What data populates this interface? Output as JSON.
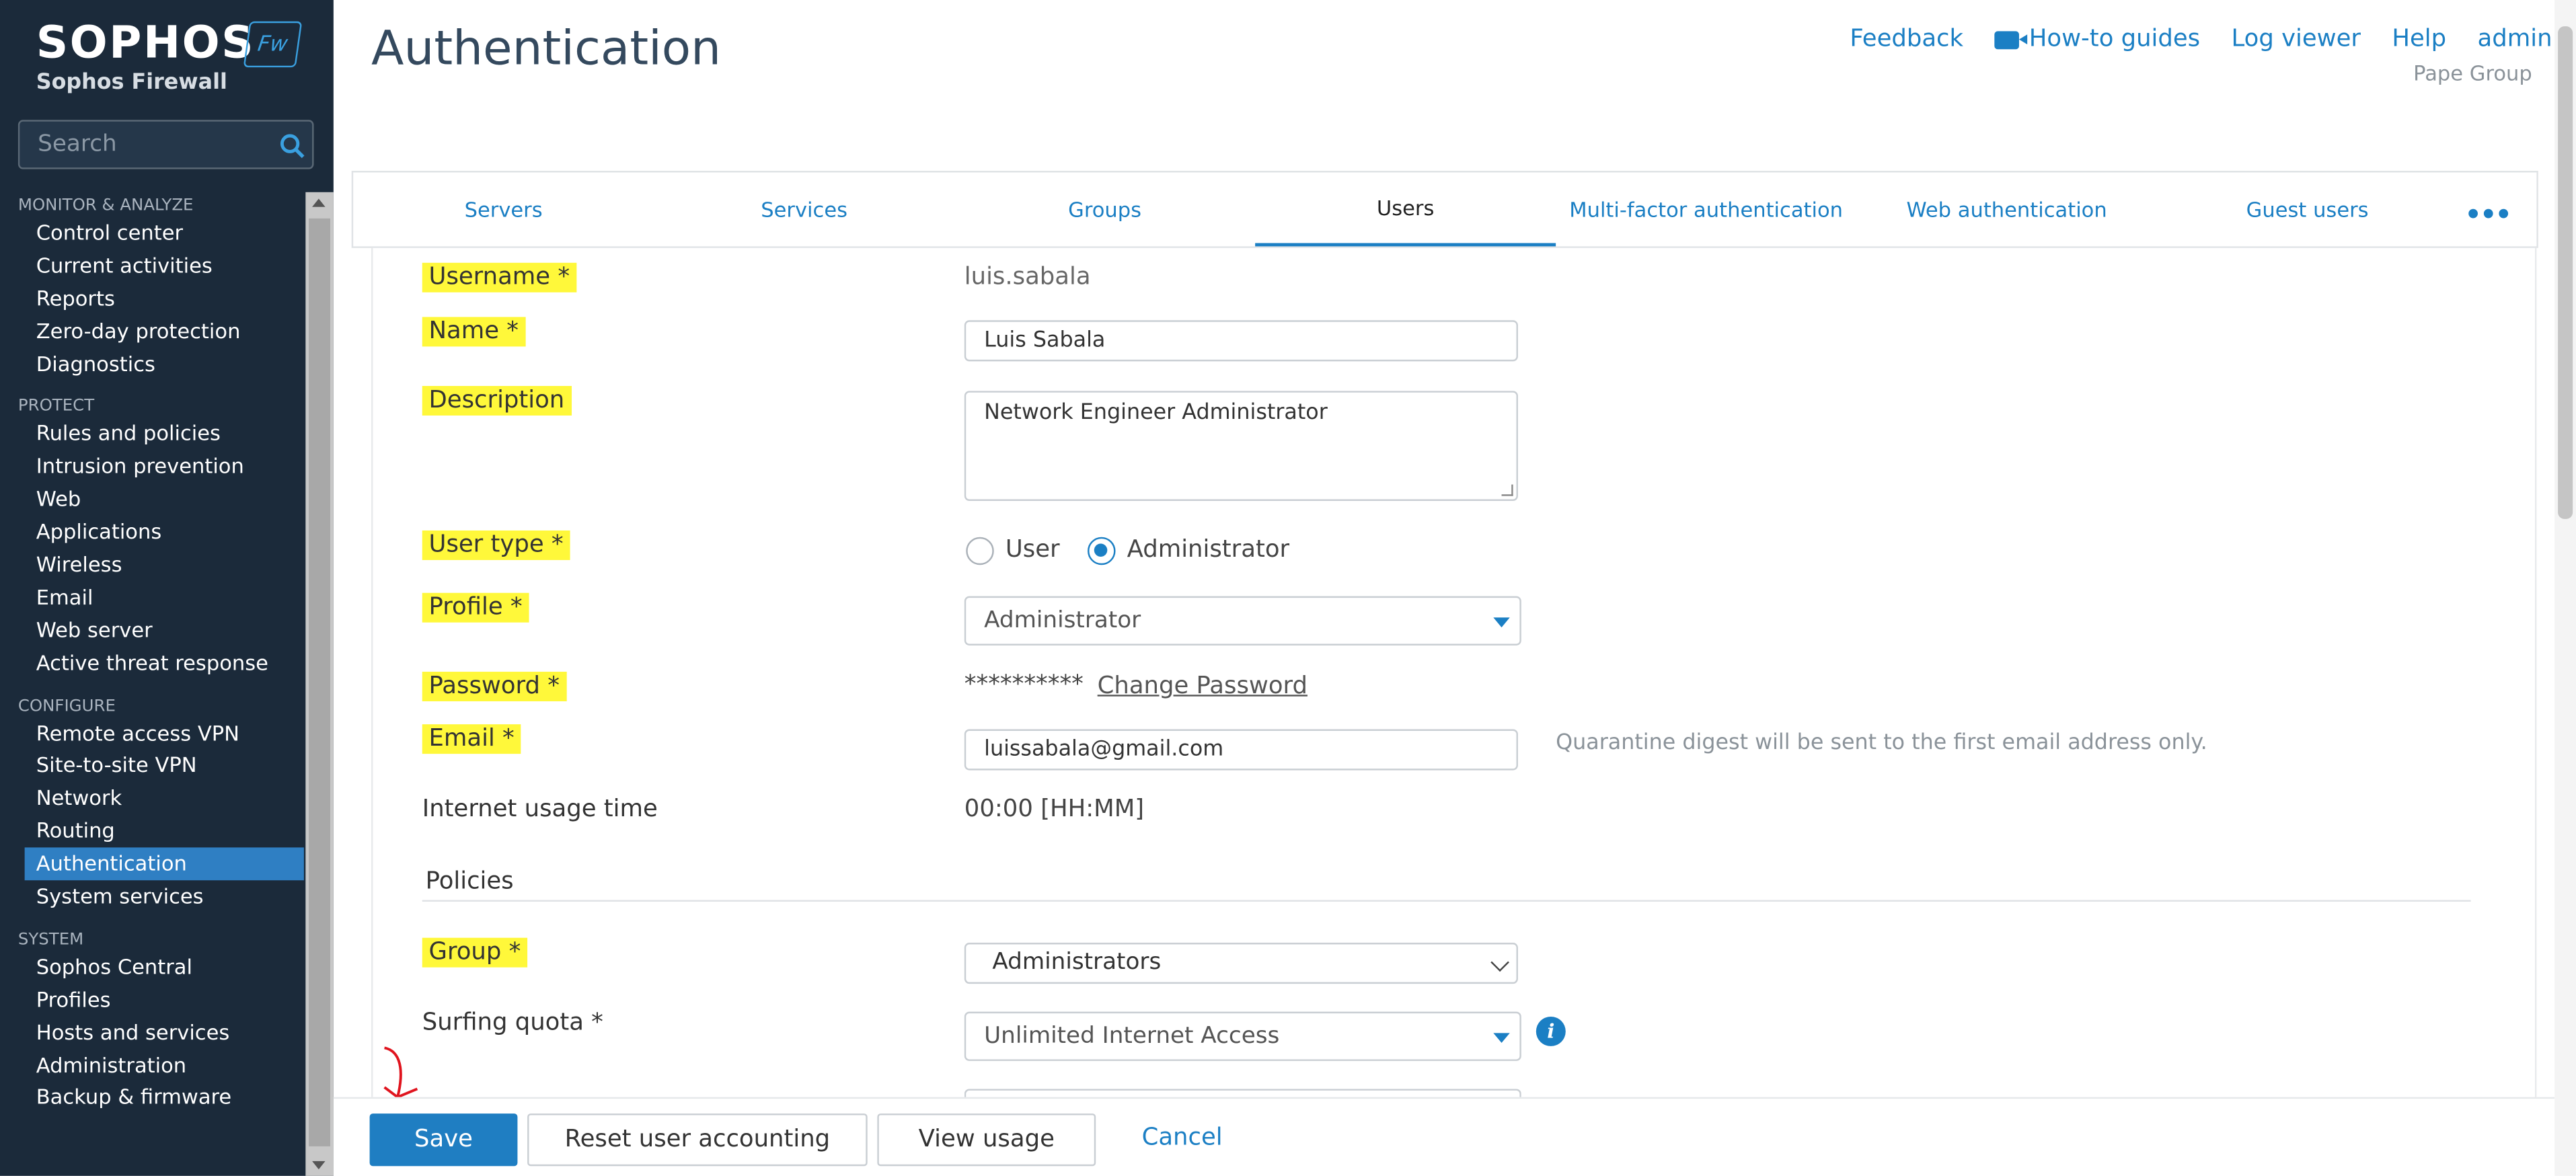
{
  "brand": {
    "name": "SOPHOS",
    "product": "Sophos Firewall",
    "badge": "Fw"
  },
  "search": {
    "placeholder": "Search"
  },
  "nav": {
    "sections": [
      {
        "title": "MONITOR & ANALYZE",
        "items": [
          "Control center",
          "Current activities",
          "Reports",
          "Zero-day protection",
          "Diagnostics"
        ]
      },
      {
        "title": "PROTECT",
        "items": [
          "Rules and policies",
          "Intrusion prevention",
          "Web",
          "Applications",
          "Wireless",
          "Email",
          "Web server",
          "Active threat response"
        ]
      },
      {
        "title": "CONFIGURE",
        "items": [
          "Remote access VPN",
          "Site-to-site VPN",
          "Network",
          "Routing",
          "Authentication",
          "System services"
        ]
      },
      {
        "title": "SYSTEM",
        "items": [
          "Sophos Central",
          "Profiles",
          "Hosts and services",
          "Administration",
          "Backup & firmware"
        ]
      }
    ],
    "active": "Authentication"
  },
  "header": {
    "title": "Authentication",
    "links": {
      "feedback": "Feedback",
      "howto": "How-to guides",
      "logviewer": "Log viewer",
      "help": "Help",
      "admin": "admin"
    },
    "org": "Pape Group"
  },
  "tabs": [
    "Servers",
    "Services",
    "Groups",
    "Users",
    "Multi-factor authentication",
    "Web authentication",
    "Guest users"
  ],
  "tabs_active": "Users",
  "tabs_more": "•••",
  "form": {
    "username_label": "Username *",
    "username_value": "luis.sabala",
    "name_label": "Name *",
    "name_value": "Luis Sabala",
    "description_label": "Description",
    "description_value": "Network Engineer Administrator",
    "usertype_label": "User type *",
    "usertype_options": [
      "User",
      "Administrator"
    ],
    "usertype_selected": "Administrator",
    "profile_label": "Profile *",
    "profile_value": "Administrator",
    "password_label": "Password *",
    "password_mask": "**********",
    "change_password": "Change Password",
    "email_label": "Email *",
    "email_value": "luissabala@gmail.com",
    "email_hint": "Quarantine digest will be sent to the first email address only.",
    "usage_label": "Internet usage time",
    "usage_value": "00:00 [HH:MM]",
    "policies_title": "Policies",
    "group_label": "Group *",
    "group_value": "Administrators",
    "quota_label": "Surfing quota *",
    "quota_value": "Unlimited Internet Access"
  },
  "footer": {
    "save": "Save",
    "reset": "Reset user accounting",
    "usage": "View usage",
    "cancel": "Cancel"
  },
  "colors": {
    "sidebar": "#1b2a3a",
    "accent": "#1b7fc4",
    "highlight": "#fff83a",
    "active_nav": "#2f7fc3"
  }
}
